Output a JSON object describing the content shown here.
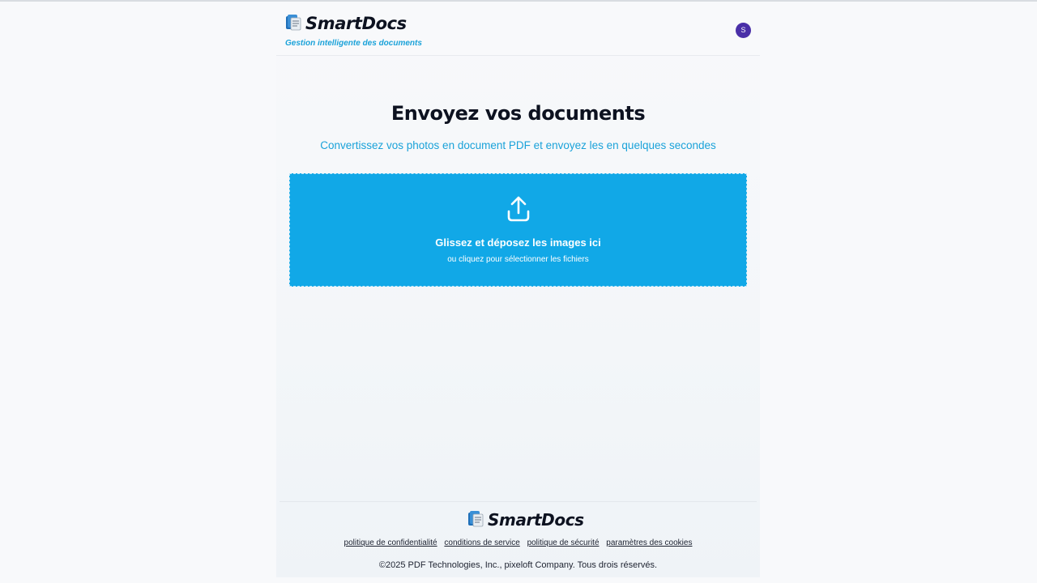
{
  "header": {
    "brand_name": "SmartDocs",
    "tagline": "Gestion intelligente des documents",
    "avatar_initial": "S",
    "logo_icon": "document-stack-icon"
  },
  "main": {
    "title": "Envoyez vos documents",
    "subtitle": "Convertissez vos photos en document PDF et envoyez les en quelques secondes",
    "dropzone": {
      "icon": "upload-icon",
      "main_text": "Glissez et déposez les images ici",
      "sub_text": "ou cliquez pour sélectionner les fichiers"
    }
  },
  "footer": {
    "brand_name": "SmartDocs",
    "links": [
      "politique de confidentialité",
      "conditions de service",
      "politique de sécurité",
      "paramètres des cookies"
    ],
    "copyright": "©2025 PDF Technologies, Inc., pixeloft Company. Tous drois réservés."
  },
  "colors": {
    "accent": "#11a8e7",
    "link_blue": "#1aa2d9",
    "avatar": "#4a2fa8",
    "text_dark": "#0d1220"
  }
}
